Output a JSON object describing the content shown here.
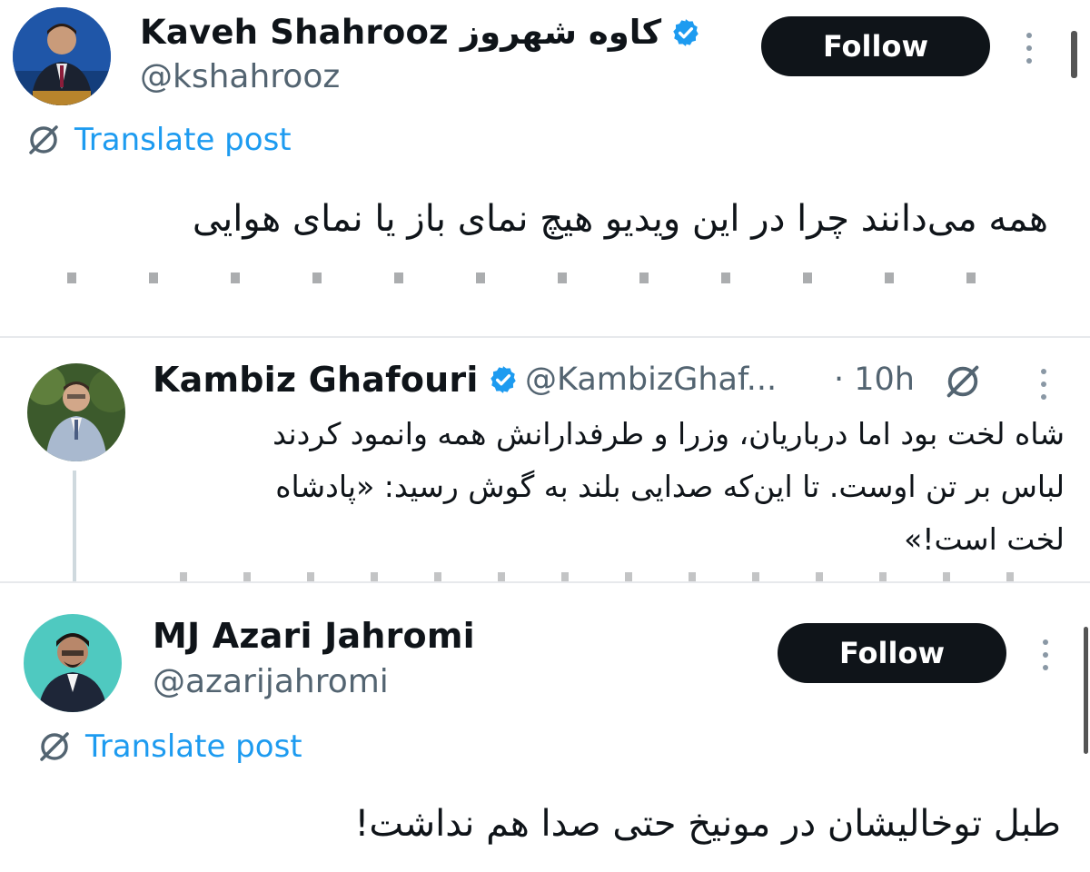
{
  "posts": [
    {
      "display_name": "Kaveh Shahrooz کاوه شهروز",
      "handle": "@kshahrooz",
      "follow_label": "Follow",
      "translate_label": "Translate post",
      "body_lines": [
        "همه می‌دانند چرا در این ویدیو هیچ نمای باز یا نمای هوایی"
      ],
      "verified_icon": "verified-badge-icon",
      "accent": "#1d9bf0"
    },
    {
      "display_name": "Kambiz Ghafouri",
      "handle": "@KambizGhaf...",
      "time": "· 10h",
      "body_lines": [
        "شاه لخت بود اما درباریان، وزرا و طرفدارانش همه وانمود کردند",
        "لباس بر تن اوست. تا این‌که صدایی بلند به گوش رسید: «پادشاه",
        "لخت است!»"
      ],
      "verified_icon": "verified-badge-icon"
    },
    {
      "display_name": "MJ Azari Jahromi",
      "handle": "@azarijahromi",
      "follow_label": "Follow",
      "translate_label": "Translate post",
      "body_lines": [
        "طبل توخالیشان در مونیخ حتی صدا هم نداشت!"
      ]
    }
  ],
  "colors": {
    "link": "#1d9bf0",
    "text": "#0f1419",
    "secondary": "#536471",
    "button": "#0f1419",
    "divider": "#e7e9ec"
  }
}
